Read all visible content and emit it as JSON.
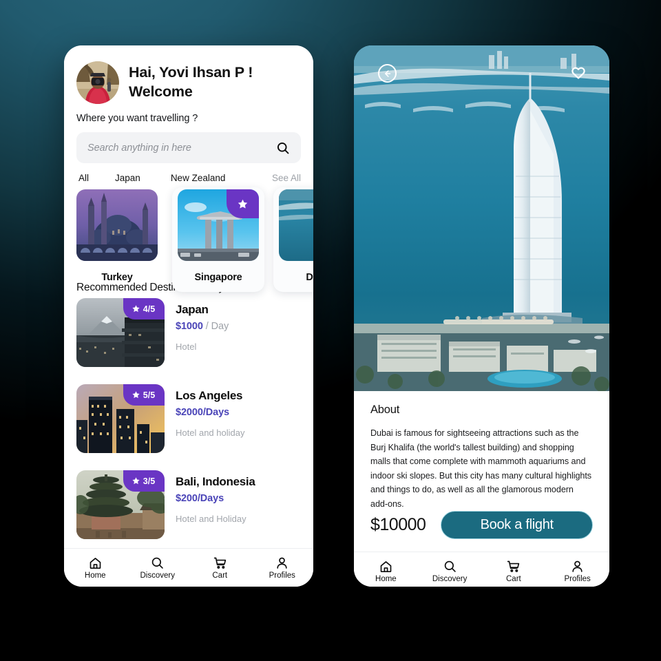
{
  "theme": {
    "accent_purple": "#6a35c4",
    "accent_teal": "#1b6b80",
    "price_purple": "#4b45b8",
    "bg_gradient_from": "#256378",
    "bg_gradient_to": "#000000"
  },
  "home": {
    "greeting_line1": "Hai, Yovi Ihsan P !",
    "greeting_line2": "Welcome",
    "question": "Where you want travelling ?",
    "search": {
      "placeholder": "Search anything in here",
      "value": ""
    },
    "tabs": [
      {
        "label": "All"
      },
      {
        "label": "Japan"
      },
      {
        "label": "New Zealand"
      },
      {
        "label": "See All"
      }
    ],
    "destinations": [
      {
        "name": "Turkey",
        "featured": false
      },
      {
        "name": "Singapore",
        "featured": true
      },
      {
        "name": "Dubai",
        "featured": false
      }
    ],
    "recommended_title": "Recommended Destination for you",
    "recommendations": [
      {
        "name": "Japan",
        "rating": "4/5",
        "price": "$1000",
        "per": " / Day",
        "category": "Hotel"
      },
      {
        "name": "Los Angeles",
        "rating": "5/5",
        "price": "$2000",
        "per": "/Days",
        "category": "Hotel and holiday"
      },
      {
        "name": "Bali, Indonesia",
        "rating": "3/5",
        "price": "$200",
        "per": "/Days",
        "category": "Hotel and Holiday"
      }
    ]
  },
  "detail": {
    "back_icon": "arrow-left-circle-icon",
    "favorite_icon": "heart-icon",
    "about_heading": "About",
    "about_text": "Dubai is famous for sightseeing attractions such as the Burj Khalifa (the world's tallest building) and shopping malls that come complete with mammoth aquariums and indoor ski slopes. But this city has many cultural highlights and things to do, as well as all the glamorous modern add-ons.",
    "price": "$10000",
    "book_label": "Book a flight"
  },
  "navbar": {
    "items": [
      {
        "label": "Home",
        "icon": "home-icon"
      },
      {
        "label": "Discovery",
        "icon": "search-icon"
      },
      {
        "label": "Cart",
        "icon": "cart-icon"
      },
      {
        "label": "Profiles",
        "icon": "person-icon"
      }
    ]
  }
}
